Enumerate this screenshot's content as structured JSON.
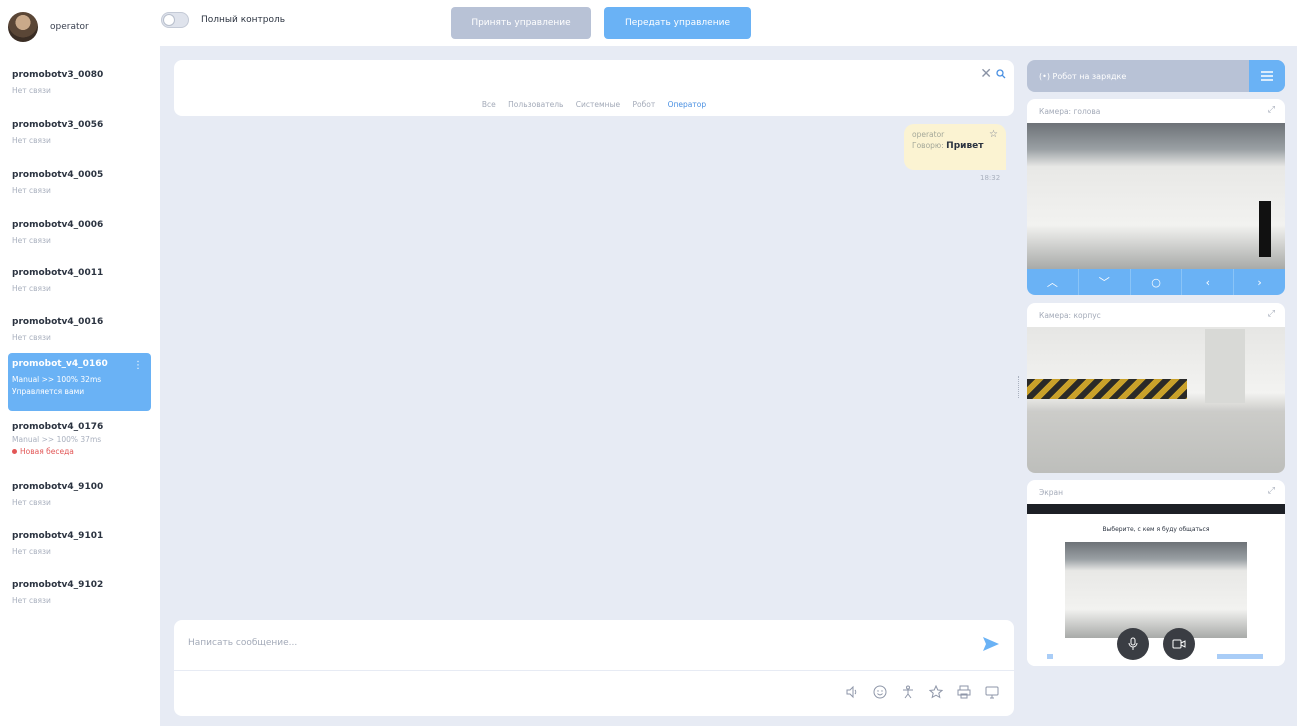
{
  "user": {
    "name": "operator"
  },
  "header": {
    "full_control_label": "Полный контроль",
    "accept_button": "Принять управление",
    "transfer_button": "Передать управление"
  },
  "robots": [
    {
      "name": "promobotv3_0080",
      "status": "Нет связи"
    },
    {
      "name": "promobotv3_0056",
      "status": "Нет связи"
    },
    {
      "name": "promobotv4_0005",
      "status": "Нет связи"
    },
    {
      "name": "promobotv4_0006",
      "status": "Нет связи"
    },
    {
      "name": "promobotv4_0011",
      "status": "Нет связи"
    },
    {
      "name": "promobotv4_0016",
      "status": "Нет связи"
    },
    {
      "name": "promobot_v4_0160",
      "status": "Manual >> 100% 32ms",
      "sub": "Управляется вами",
      "active": true
    },
    {
      "name": "promobotv4_0176",
      "status": "Manual >> 100% 37ms",
      "alert": "Новая беседа"
    },
    {
      "name": "promobotv4_9100",
      "status": "Нет связи"
    },
    {
      "name": "promobotv4_9101",
      "status": "Нет связи"
    },
    {
      "name": "promobotv4_9102",
      "status": "Нет связи"
    }
  ],
  "chat": {
    "filters": [
      "Все",
      "Пользователь",
      "Системные",
      "Робот",
      "Оператор"
    ],
    "active_filter": "Оператор",
    "messages": [
      {
        "author": "operator",
        "prefix": "Говорю:",
        "text": "Привет",
        "time": "18:32"
      }
    ],
    "composer_placeholder": "Написать сообщение..."
  },
  "tools": [
    "volume-icon",
    "emoji-icon",
    "gesture-icon",
    "star-icon",
    "print-icon",
    "screen-icon"
  ],
  "right_panel": {
    "header_label": "(•) Робот на зарядке",
    "cam_head_title": "Камера: голова",
    "cam_body_title": "Камера: корпус",
    "screen_title": "Экран",
    "screen_caption": "Выберите, с кем я буду общаться"
  },
  "colors": {
    "accent": "#6ab2f5",
    "disabled": "#b8c2d6",
    "background": "#e7ebf4",
    "alert": "#e25656"
  }
}
